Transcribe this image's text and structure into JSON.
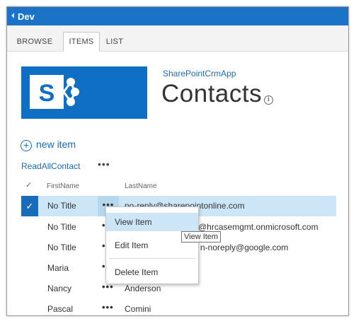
{
  "topbar": {
    "title": "Dev"
  },
  "ribbon": {
    "tabs": [
      {
        "label": "BROWSE"
      },
      {
        "label": "ITEMS"
      },
      {
        "label": "LIST"
      }
    ]
  },
  "app": {
    "link_label": "SharePointCrmApp",
    "page_title": "Contacts"
  },
  "actions": {
    "new_item_label": "new item",
    "view_name": "ReadAllContact",
    "view_menu": "•••"
  },
  "columns": {
    "check": "✓",
    "first": "FirstName",
    "last": "LastName"
  },
  "rows": [
    {
      "first": "No Title",
      "last": "no-reply@sharepointonline.com",
      "dots": "•••"
    },
    {
      "first": "No Title",
      "last": "@hrcasemgmt.onmicrosoft.com",
      "dots": "•••"
    },
    {
      "first": "No Title",
      "last": "n-noreply@google.com",
      "dots": "•••"
    },
    {
      "first": "Maria",
      "last": "",
      "dots": "•••"
    },
    {
      "first": "Nancy",
      "last": "Anderson",
      "dots": "•••"
    },
    {
      "first": "Pascal",
      "last": "Comini",
      "dots": "•••"
    }
  ],
  "context_menu": {
    "items": [
      {
        "label": "View Item"
      },
      {
        "label": "Edit Item"
      },
      {
        "label": "Delete Item"
      }
    ]
  },
  "tooltip": {
    "text": "View Item"
  },
  "colors": {
    "accent": "#1a73c7",
    "selected_row": "#cde6f7",
    "link": "#1a6bb8"
  }
}
